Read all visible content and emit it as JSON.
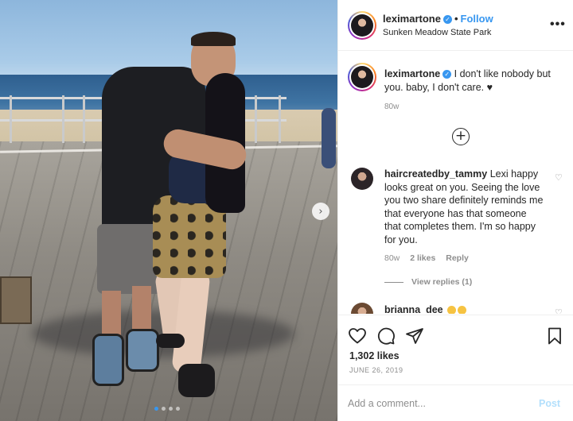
{
  "post": {
    "username": "leximartone",
    "follow_label": "Follow",
    "separator": "•",
    "location": "Sunken Meadow State Park",
    "more_label": "•••",
    "caption": "I don't like nobody but you. baby, I don't care. ♥",
    "caption_time": "80w",
    "load_more_icon": "+",
    "likes": "1,302 likes",
    "date": "JUNE 26, 2019",
    "image_dots": 4,
    "active_dot": 0
  },
  "comments": [
    {
      "username": "haircreatedby_tammy",
      "text": "Lexi happy looks great on you. Seeing the love you two share definitely reminds me that everyone has that someone that completes them. I'm so happy for you.",
      "time": "80w",
      "likes": "2 likes",
      "reply_label": "Reply",
      "view_replies": "View replies (1)"
    },
    {
      "username": "brianna_dee",
      "text": ""
    }
  ],
  "add_comment": {
    "placeholder": "Add a comment...",
    "post_label": "Post"
  },
  "colors": {
    "accent": "#3897f0",
    "muted": "#8e8e8e",
    "post_disabled": "#b2dffc"
  }
}
